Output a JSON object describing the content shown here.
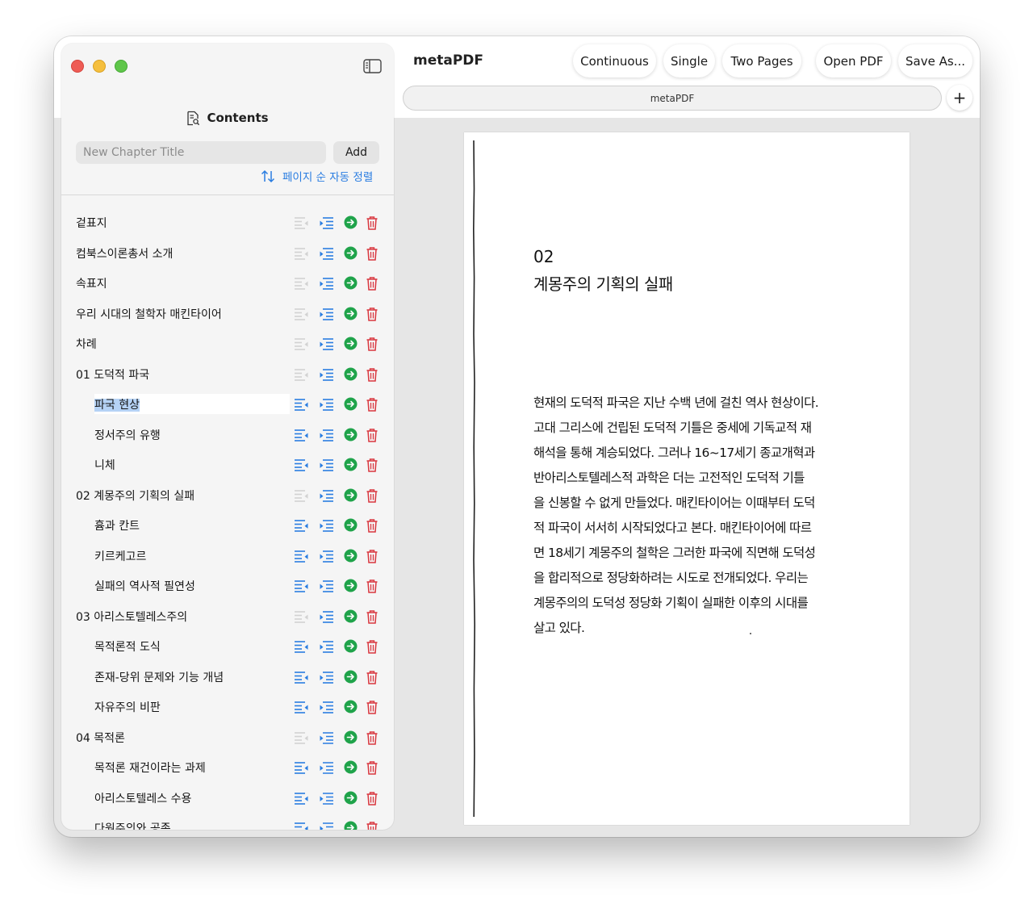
{
  "app": {
    "title": "metaPDF"
  },
  "toolbar": {
    "continuous": "Continuous",
    "single": "Single",
    "two_pages": "Two Pages",
    "open_pdf": "Open PDF",
    "save_as": "Save As..."
  },
  "tab": {
    "label": "metaPDF",
    "add": "+"
  },
  "sidebar": {
    "header": "Contents",
    "new_chapter_placeholder": "New Chapter Title",
    "add_label": "Add",
    "sort_label": "페이지 순 자동 정렬"
  },
  "toc": [
    {
      "label": "겉표지",
      "level": 0
    },
    {
      "label": "컴북스이론총서 소개",
      "level": 0
    },
    {
      "label": "속표지",
      "level": 0
    },
    {
      "label": "우리 시대의 철학자 매킨타이어",
      "level": 0
    },
    {
      "label": "차례",
      "level": 0
    },
    {
      "label": "01 도덕적 파국",
      "level": 0
    },
    {
      "label": "파국 현상",
      "level": 1,
      "selected": true
    },
    {
      "label": "정서주의 유행",
      "level": 1
    },
    {
      "label": "니체",
      "level": 1
    },
    {
      "label": "02 계몽주의 기획의 실패",
      "level": 0
    },
    {
      "label": "흄과 칸트",
      "level": 1
    },
    {
      "label": "키르케고르",
      "level": 1
    },
    {
      "label": "실패의 역사적 필연성",
      "level": 1
    },
    {
      "label": "03 아리스토텔레스주의",
      "level": 0
    },
    {
      "label": "목적론적 도식",
      "level": 1
    },
    {
      "label": "존재-당위 문제와 기능 개념",
      "level": 1
    },
    {
      "label": "자유주의 비판",
      "level": 1
    },
    {
      "label": "04 목적론",
      "level": 0
    },
    {
      "label": "목적론 재건이라는 과제",
      "level": 1
    },
    {
      "label": "아리스토텔레스 수용",
      "level": 1
    },
    {
      "label": "다원주의와 공존",
      "level": 1
    }
  ],
  "document": {
    "chapter_number": "02",
    "chapter_title": "계몽주의 기획의 실패",
    "body_lines": [
      "현재의 도덕적 파국은 지난 수백 년에 걸친 역사 현상이다.",
      "고대 그리스에 건립된 도덕적 기틀은 중세에 기독교적 재",
      "해석을 통해 계승되었다. 그러나 16~17세기 종교개혁과",
      "반아리스토텔레스적 과학은 더는 고전적인 도덕적 기틀",
      "을 신봉할 수 없게 만들었다. 매킨타이어는 이때부터 도덕",
      "적 파국이 서서히 시작되었다고 본다. 매킨타이어에 따르",
      "면 18세기 계몽주의 철학은 그러한 파국에 직면해 도덕성",
      "을 합리적으로 정당화하려는 시도로 전개되었다. 우리는",
      "계몽주의의 도덕성 정당화 기획이 실패한 이후의 시대를",
      "살고 있다."
    ]
  },
  "colors": {
    "accent_blue": "#2a7de1",
    "go_green": "#1fa34a",
    "delete_red": "#d9363e",
    "disabled_gray": "#d2d2d2",
    "selection": "#b5d2f5"
  },
  "icons": {
    "sidebar_toggle": "sidebar-toggle-icon",
    "contents": "document-search-icon",
    "sort": "sort-arrows-icon",
    "outdent": "outdent-icon",
    "indent": "indent-icon",
    "go": "arrow-circle-right-icon",
    "delete": "trash-icon"
  }
}
